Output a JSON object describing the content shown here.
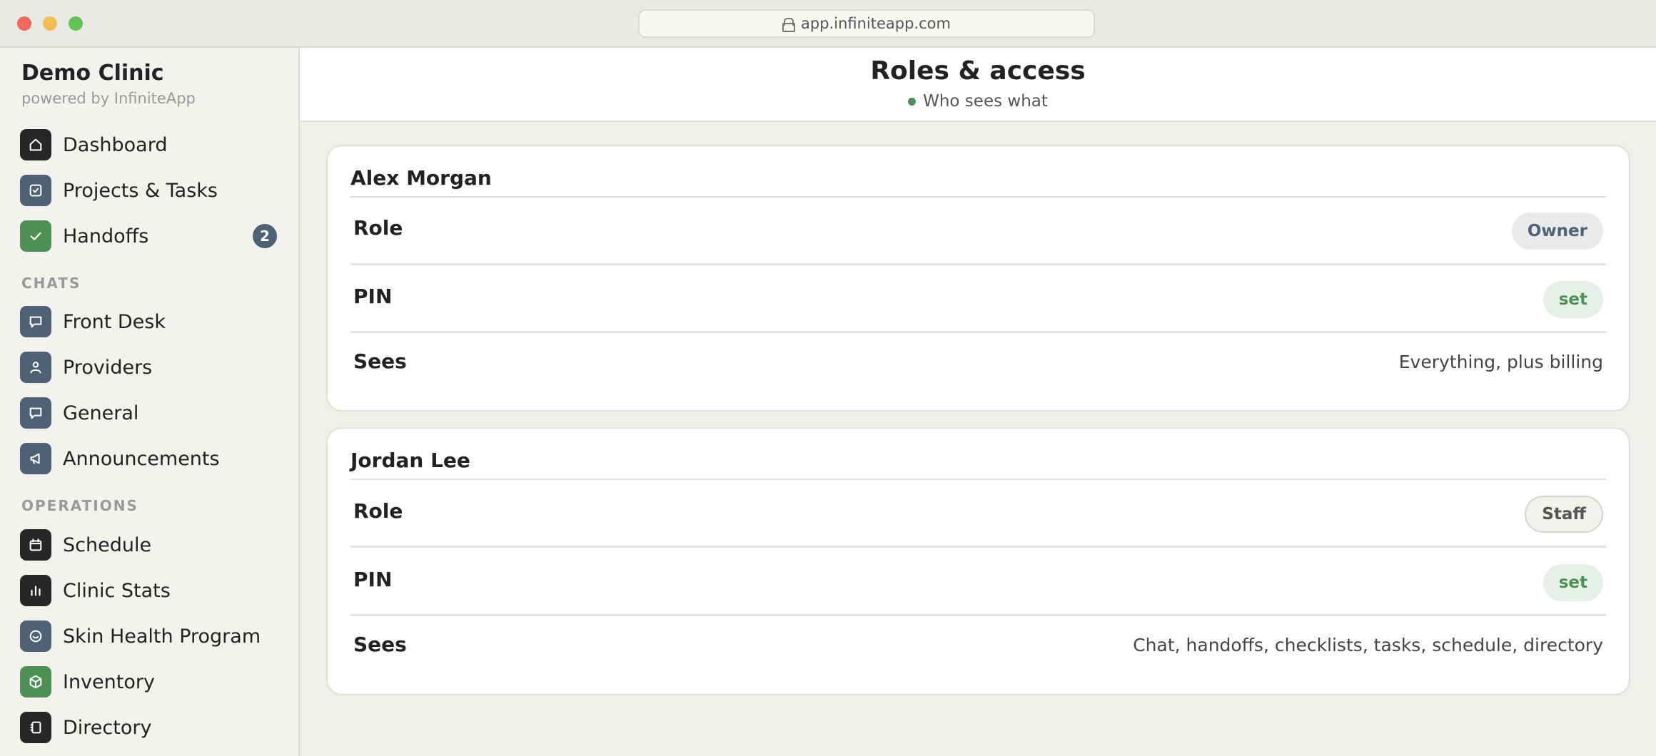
{
  "browser": {
    "url": "app.infiniteapp.com"
  },
  "sidebar": {
    "brand": "Demo Clinic",
    "powered_by": "powered by InfiniteApp",
    "items": [
      {
        "label": "Dashboard",
        "icon": "home-icon"
      },
      {
        "label": "Projects & Tasks",
        "icon": "checkbox-icon"
      },
      {
        "label": "Handoffs",
        "icon": "check-icon",
        "badge": "2"
      }
    ],
    "chats_heading": "CHATS",
    "chats": [
      {
        "label": "Front Desk",
        "icon": "chat-icon"
      },
      {
        "label": "Providers",
        "icon": "person-icon"
      },
      {
        "label": "General",
        "icon": "chat-icon"
      },
      {
        "label": "Announcements",
        "icon": "megaphone-icon"
      }
    ],
    "operations_heading": "OPERATIONS",
    "operations": [
      {
        "label": "Schedule",
        "icon": "calendar-icon"
      },
      {
        "label": "Clinic Stats",
        "icon": "bar-chart-icon"
      },
      {
        "label": "Skin Health Program",
        "icon": "smile-icon"
      },
      {
        "label": "Inventory",
        "icon": "box-icon"
      },
      {
        "label": "Directory",
        "icon": "contacts-icon"
      }
    ]
  },
  "header": {
    "title": "Roles & access",
    "subtitle": "Who sees what"
  },
  "users": [
    {
      "name": "Alex Morgan",
      "role_label": "Role",
      "role": "Owner",
      "pin_label": "PIN",
      "pin": "set",
      "sees_label": "Sees",
      "sees": "Everything, plus billing"
    },
    {
      "name": "Jordan Lee",
      "role_label": "Role",
      "role": "Staff",
      "pin_label": "PIN",
      "pin": "set",
      "sees_label": "Sees",
      "sees": "Chat, handoffs, checklists, tasks, schedule, directory"
    }
  ],
  "colors": {
    "accent_green": "#4d8f55",
    "slate": "#4f6275",
    "dark": "#272727"
  }
}
